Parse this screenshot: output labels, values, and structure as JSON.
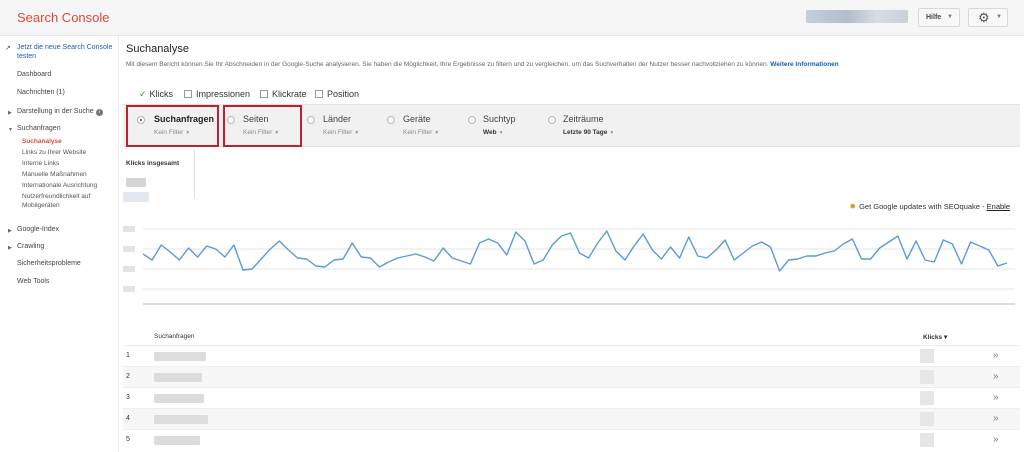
{
  "app": {
    "brand": "Search Console"
  },
  "topbar": {
    "help_label": "Hilfe"
  },
  "sidebar": {
    "new_console_link": "Jetzt die neue Search Console testen",
    "dashboard": "Dashboard",
    "messages": "Nachrichten (1)",
    "appearance": "Darstellung in der Suche",
    "search_queries": "Suchanfragen",
    "sub_items": [
      "Suchanalyse",
      "Links zu Ihrer Website",
      "Interne Links",
      "Manuelle Maßnahmen",
      "Internationale Ausrichtung",
      "Nutzerfreundlichkeit auf",
      "Mobilgeräten"
    ],
    "google_index": "Google-Index",
    "crawling": "Crawling",
    "security": "Sicherheitsprobleme",
    "web_tools": "Web Tools"
  },
  "main": {
    "title": "Suchanalyse",
    "description": "Mit diesem Bericht können Sie Ihr Abschneiden in der Google-Suche analysieren. Sie haben die Möglichkeit, Ihre Ergebnisse zu filtern und zu vergleichen, um das Suchverhalten der Nutzer besser nachvollziehen zu können.",
    "more_info": "Weitere Informationen"
  },
  "metrics": [
    {
      "label": "Klicks",
      "checked": true
    },
    {
      "label": "Impressionen",
      "checked": false
    },
    {
      "label": "Klickrate",
      "checked": false
    },
    {
      "label": "Position",
      "checked": false
    }
  ],
  "filters": [
    {
      "label": "Suchanfragen",
      "sub": "Kein Filter",
      "selected": true
    },
    {
      "label": "Seiten",
      "sub": "Kein Filter",
      "selected": false
    },
    {
      "label": "Länder",
      "sub": "Kein Filter",
      "selected": false
    },
    {
      "label": "Geräte",
      "sub": "Kein Filter",
      "selected": false
    },
    {
      "label": "Suchtyp",
      "sub": "Web",
      "selected": false
    },
    {
      "label": "Zeiträume",
      "sub": "Letzte 90 Tage",
      "selected": false
    }
  ],
  "klicks_panel": {
    "title": "Klicks insgesamt"
  },
  "seoquake": {
    "text": "Get Google updates with SEOquake - ",
    "link": "Enable"
  },
  "table": {
    "col_query": "Suchanfragen",
    "col_clicks": "Klicks ▾",
    "rows": [
      "1",
      "2",
      "3",
      "4",
      "5"
    ]
  },
  "colors": {
    "brand": "#dd4b39",
    "highlight": "#c0202c",
    "line": "#5a9bd5",
    "link": "#1a5cb6"
  },
  "chart_data": {
    "type": "line",
    "series": [
      {
        "values": [
          50,
          44,
          59,
          52,
          44,
          56,
          47,
          58,
          55,
          47,
          59,
          34,
          35,
          45,
          55,
          63,
          54,
          46,
          45,
          38,
          37,
          44,
          45,
          61,
          47,
          46,
          37,
          42,
          46,
          48,
          50,
          47,
          43,
          56,
          46,
          43,
          40,
          61,
          65,
          61,
          49,
          72,
          63,
          40,
          44,
          59,
          68,
          71,
          51,
          46,
          61,
          73,
          53,
          44,
          58,
          70,
          54,
          45,
          57,
          46,
          67,
          48,
          46,
          54,
          64,
          44,
          51,
          58,
          62,
          57,
          33,
          44,
          45,
          48,
          48,
          51,
          53,
          60,
          65,
          45,
          45,
          56,
          62,
          68,
          45,
          63,
          44,
          42,
          64,
          60,
          40,
          62,
          58,
          54,
          38,
          41
        ]
      }
    ]
  },
  "icons": {
    "new_console": "external-link-icon",
    "settings": "gear-icon",
    "details": "chevron-double-right-icon",
    "info": "info-icon"
  }
}
